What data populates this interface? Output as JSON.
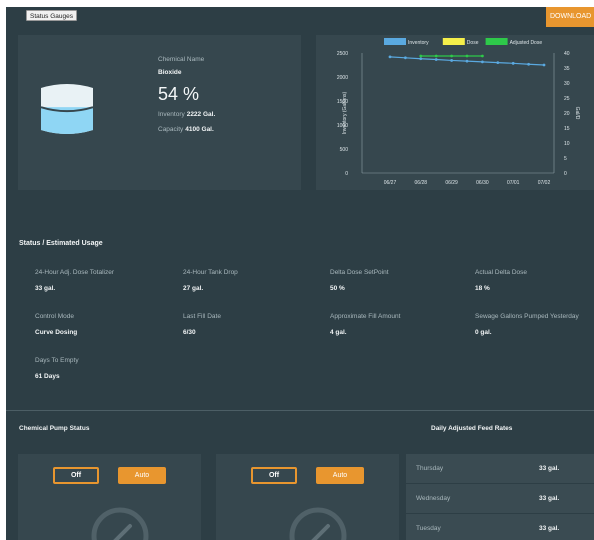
{
  "page": {
    "tab_label": "Status Gauges",
    "download_label": "DOWNLOAD"
  },
  "tank": {
    "chemical_name_label": "Chemical Name",
    "chemical_name": "Bioxide",
    "percent": "54 %",
    "inventory_label": "Inventory",
    "inventory_value": "2222 Gal.",
    "capacity_label": "Capacity",
    "capacity_value": "4100 Gal.",
    "fill_fraction": 0.54,
    "fill_color": "#8fd6f4"
  },
  "chart_data": {
    "type": "line",
    "legend": [
      {
        "name": "Inventory",
        "color": "#5aa9e0"
      },
      {
        "name": "Dose",
        "color": "#f5ef4a"
      },
      {
        "name": "Adjusted Dose",
        "color": "#2ec94a"
      }
    ],
    "categories": [
      "06/27",
      "06/28",
      "06/29",
      "06/30",
      "07/01",
      "07/02"
    ],
    "y_left_label": "Inventory (Gallons)",
    "y_right_label": "Gal/D",
    "y_left_ticks": [
      "2500",
      "2000",
      "1500",
      "1000",
      "500",
      "0"
    ],
    "y_right_ticks": [
      "40",
      "35",
      "30",
      "25",
      "20",
      "15",
      "10",
      "5",
      "0"
    ],
    "y_left_range": [
      0,
      2500
    ],
    "y_right_range": [
      0,
      40
    ],
    "series": [
      {
        "name": "Inventory",
        "axis": "left",
        "color": "#5aa9e0",
        "x": [
          0,
          0.5,
          1,
          1.5,
          2,
          2.5,
          3,
          3.5,
          4,
          4.5,
          5
        ],
        "values": [
          2420,
          2400,
          2380,
          2365,
          2345,
          2330,
          2315,
          2300,
          2285,
          2265,
          2250
        ]
      },
      {
        "name": "Adjusted Dose",
        "axis": "right",
        "color": "#2ec94a",
        "x": [
          1,
          1.5,
          2,
          2.5,
          3
        ],
        "values": [
          39,
          39,
          39,
          39,
          39
        ]
      }
    ]
  },
  "status": {
    "title": "Status / Estimated Usage",
    "items": [
      {
        "label": "24-Hour Adj. Dose Totalizer",
        "value": "33 gal."
      },
      {
        "label": "24-Hour Tank Drop",
        "value": "27 gal."
      },
      {
        "label": "Delta Dose SetPoint",
        "value": "50 %"
      },
      {
        "label": "Actual Delta Dose",
        "value": "18 %"
      },
      {
        "label": "Control Mode",
        "value": "Curve Dosing"
      },
      {
        "label": "Last Fill Date",
        "value": "6/30"
      },
      {
        "label": "Approximate Fill Amount",
        "value": "4 gal."
      },
      {
        "label": "Sewage Gallons Pumped Yesterday",
        "value": "0 gal."
      },
      {
        "label": "Days To Empty",
        "value": "61 Days"
      }
    ]
  },
  "pumps": {
    "title": "Chemical Pump Status",
    "off_label": "Off",
    "auto_label": "Auto"
  },
  "feed_rates": {
    "title": "Daily Adjusted Feed Rates",
    "rows": [
      {
        "day": "Thursday",
        "rate": "33 gal."
      },
      {
        "day": "Wednesday",
        "rate": "33 gal."
      },
      {
        "day": "Tuesday",
        "rate": "33 gal."
      }
    ]
  },
  "colors": {
    "accent": "#e8962f",
    "background": "#2d3e45",
    "card": "#36474e"
  }
}
